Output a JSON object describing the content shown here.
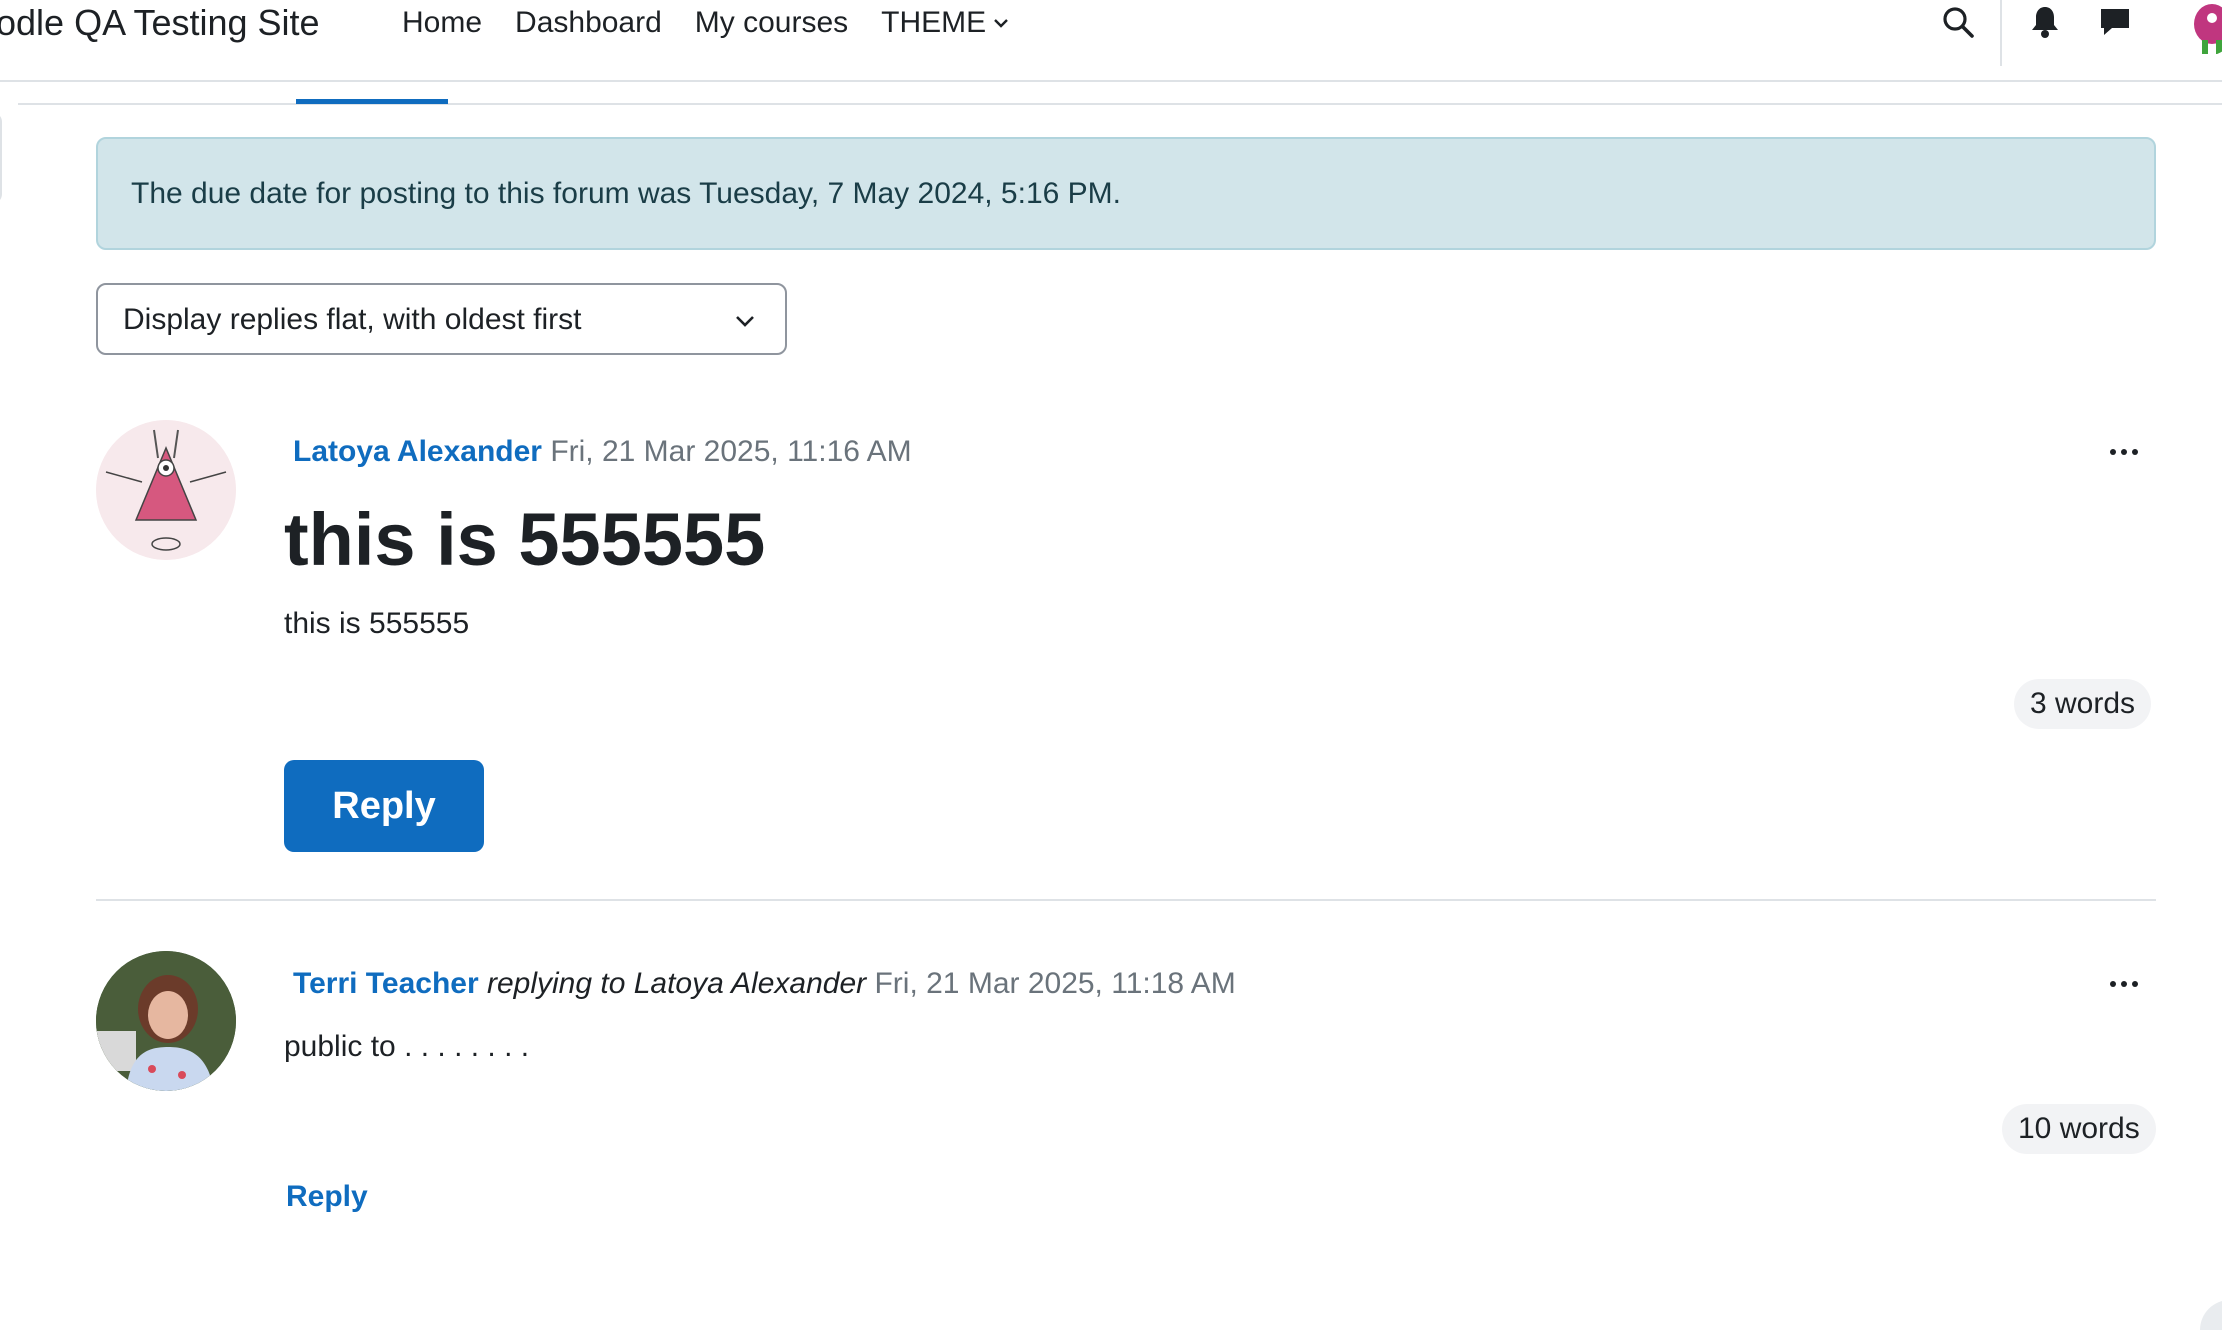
{
  "navbar": {
    "site_name": "odle QA Testing Site",
    "links": [
      "Home",
      "Dashboard",
      "My courses"
    ],
    "theme_label": "THEME",
    "icons": [
      "search-icon",
      "bell-icon",
      "chat-icon",
      "avatar"
    ]
  },
  "alert": {
    "text": "The due date for posting to this forum was Tuesday, 7 May 2024, 5:16 PM."
  },
  "display_mode": {
    "selected": "Display replies flat, with oldest first"
  },
  "posts": [
    {
      "author": "Latoya Alexander",
      "date": "Fri, 21 Mar 2025, 11:16 AM",
      "subject": "this is 555555",
      "body": "this is 555555",
      "word_count": "3 words",
      "reply_label": "Reply"
    },
    {
      "author": "Terri Teacher",
      "replying_to": "replying to Latoya Alexander",
      "date": "Fri, 21 Mar 2025, 11:18 AM",
      "body": "public to . . . . . . . .",
      "word_count": "10 words",
      "reply_label": "Reply"
    }
  ],
  "colors": {
    "link": "#0f6cbf",
    "alert_bg": "#d2e5ea",
    "text": "#1d2125",
    "muted": "#6a737b"
  }
}
